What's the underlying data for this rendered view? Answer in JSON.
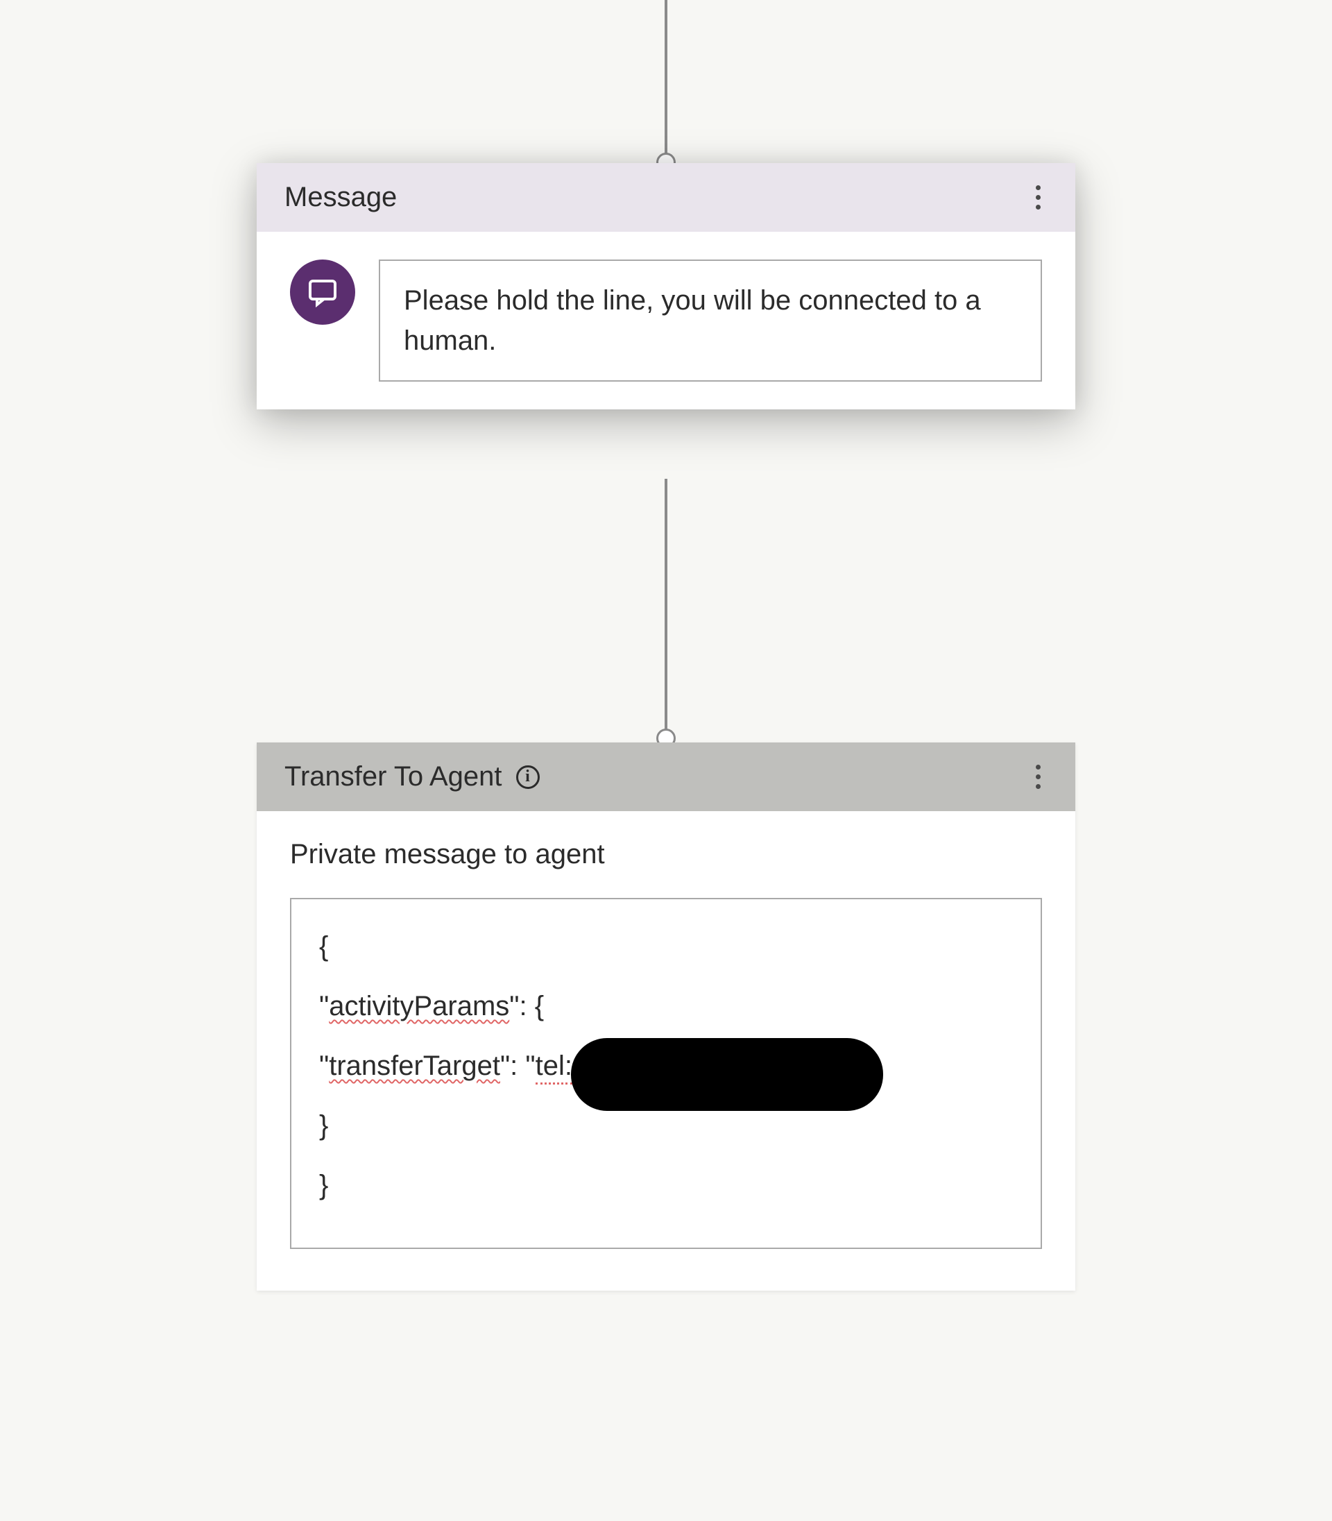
{
  "flow": {
    "node1": {
      "title": "Message",
      "message_text": "Please hold the line, you will be connected to a human."
    },
    "node2": {
      "title": "Transfer To Agent",
      "section_label": "Private message to agent",
      "code": {
        "line1": "{",
        "line2_prefix": "\"",
        "line2_key": "activityParams",
        "line2_suffix": "\": {",
        "line3_prefix": "\"",
        "line3_key": "transferTarget",
        "line3_mid": "\": \"",
        "line3_val": "tel:",
        "line4": "}",
        "line5": "}"
      }
    }
  }
}
